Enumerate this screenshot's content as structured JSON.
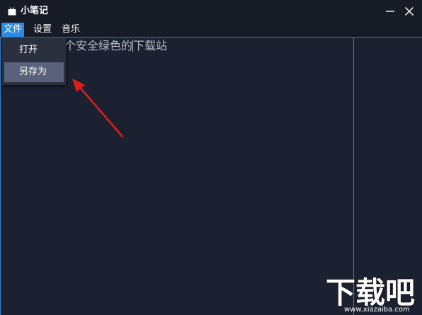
{
  "app": {
    "title": "小笔记"
  },
  "menubar": {
    "items": [
      {
        "label": "文件"
      },
      {
        "label": "设置"
      },
      {
        "label": "音乐"
      }
    ]
  },
  "file_menu": {
    "items": [
      {
        "label": "打开"
      },
      {
        "label": "另存为"
      }
    ]
  },
  "editor": {
    "text_before_caret": "一个安全绿色的",
    "text_after_caret": "下载站"
  },
  "watermark": {
    "brand": "下载吧",
    "url": "www.xiazaiba.com"
  },
  "colors": {
    "accent": "#2a8be0",
    "annotation_arrow": "#e11c1c",
    "background": "#1a202d"
  },
  "icons": {
    "app": "tv-icon",
    "minimize": "minimize-icon",
    "close": "close-icon"
  }
}
